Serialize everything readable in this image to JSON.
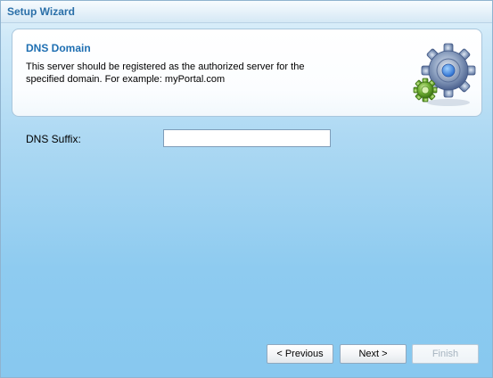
{
  "window": {
    "title": "Setup Wizard"
  },
  "header": {
    "title": "DNS Domain",
    "description": "This server should be registered as the authorized server for the specified domain. For example: myPortal.com",
    "icon": "gears-icon"
  },
  "form": {
    "dns_suffix_label": "DNS Suffix:",
    "dns_suffix_value": ""
  },
  "buttons": {
    "previous_label": "< Previous",
    "next_label": "Next >",
    "finish_label": "Finish",
    "finish_enabled": false
  },
  "colors": {
    "title_blue": "#2a6fa8",
    "header_title_blue": "#1f6fb2",
    "background_blue": "#87c8ef"
  }
}
